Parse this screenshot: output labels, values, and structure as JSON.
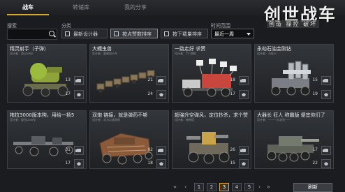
{
  "tabs": [
    {
      "label": "战车"
    },
    {
      "label": "转储库"
    },
    {
      "label": "我的分享"
    }
  ],
  "logo": {
    "title": "创世战车",
    "subtitle": "创造 操控 破坏"
  },
  "search": {
    "label": "搜索",
    "value": ""
  },
  "category": {
    "label": "分类",
    "buttons": [
      {
        "label": "最新设计器"
      },
      {
        "label": "按点赞数排序"
      },
      {
        "label": "按下载量排序"
      }
    ]
  },
  "time_range": {
    "label": "时间范围",
    "selected": "最近一周"
  },
  "cards": [
    {
      "title": "精灵射手（子弹）",
      "designer": "设计者：奇Lovefy",
      "likes": "13",
      "favs": "17"
    },
    {
      "title": "大蠕虫兽",
      "designer": "设计者：戴赖组卡车",
      "likes": "21",
      "favs": "24"
    },
    {
      "title": "一路走好 求赞",
      "designer": "设计者：TV 钢铁",
      "likes": "18",
      "favs": "17"
    },
    {
      "title": "永劫石油金刚钻",
      "designer": "设计者：马佐公",
      "likes": "15",
      "favs": "19"
    },
    {
      "title": "拖拉3000版本狗，用给一扬5",
      "designer": "设计者：现拉Lovefy",
      "likes": "31",
      "favs": "17"
    },
    {
      "title": "双炮 链接，就是弹药不够",
      "designer": "设计者：对方以迷双航",
      "likes": "92",
      "favs": "18"
    },
    {
      "title": "超強升空弹风，定位抄杀，求个赞",
      "designer": "设计者：梅神组",
      "likes": "26",
      "favs": "15"
    },
    {
      "title": "大器长 狂人 称霸版 便宜你们了",
      "designer": "设计者：———大战利——",
      "likes": "17",
      "favs": "22"
    }
  ],
  "pager": {
    "pages": [
      "1",
      "2",
      "3",
      "4",
      "5"
    ],
    "current": "3"
  },
  "refresh": {
    "label": "刷新"
  },
  "colors": {
    "accent": "#d8a632",
    "bg": "#1a1c1f"
  }
}
